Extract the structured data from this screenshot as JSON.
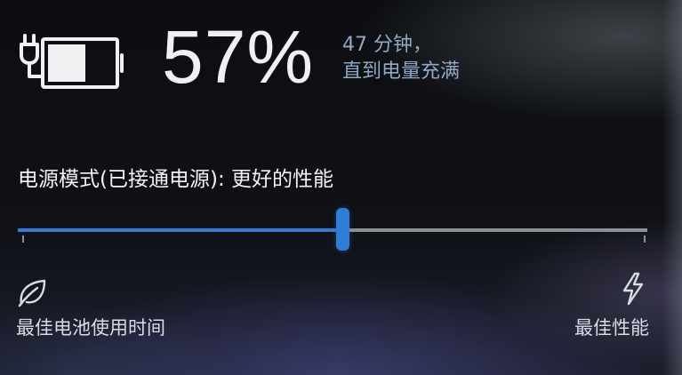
{
  "battery": {
    "percent_label": "57%",
    "charge_level": 0.57,
    "status_line1": "47 分钟，",
    "status_line2": "直到电量充满",
    "icon": "battery-charging-icon"
  },
  "power_mode": {
    "title": "电源模式(已接通电源): 更好的性能",
    "slider_position": 0.515,
    "left_label": "最佳电池使用时间",
    "right_label": "最佳性能",
    "left_icon": "leaf-icon",
    "right_icon": "lightning-bolt-icon"
  },
  "colors": {
    "accent": "#2f7dd8",
    "secondary_text": "#8fa8c6",
    "track": "#8b8f96"
  }
}
